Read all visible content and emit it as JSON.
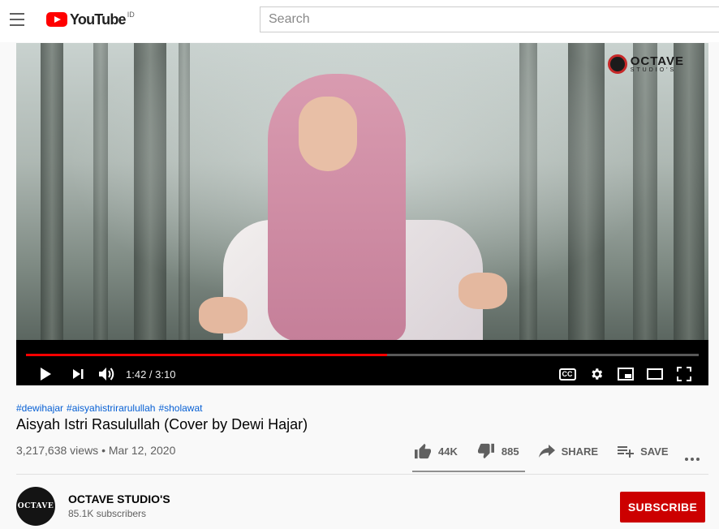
{
  "header": {
    "logo_text": "YouTube",
    "country_code": "ID",
    "search_placeholder": "Search"
  },
  "player": {
    "watermark_main": "OCTAVE",
    "watermark_sub": "STUDIO'S",
    "current_time": "1:42",
    "duration": "3:10",
    "time_display": "1:42 / 3:10",
    "progress_fraction": 0.537,
    "cc_label": "CC"
  },
  "video": {
    "hashtags": [
      "#dewihajar",
      "#aisyahistrirarulullah",
      "#sholawat"
    ],
    "title": "Aisyah Istri Rasulullah (Cover by Dewi Hajar)",
    "views": "3,217,638 views",
    "date": "Mar 12, 2020",
    "meta": "3,217,638 views • Mar 12, 2020"
  },
  "actions": {
    "likes": "44K",
    "dislikes": "885",
    "share_label": "SHARE",
    "save_label": "SAVE"
  },
  "channel": {
    "avatar_text": "OCTAVE",
    "name": "OCTAVE STUDIO'S",
    "subscribers": "85.1K subscribers",
    "subscribe_label": "SUBSCRIBE"
  },
  "colors": {
    "brand_red": "#ff0000",
    "subscribe_red": "#cc0000",
    "link_blue": "#065fd4"
  }
}
